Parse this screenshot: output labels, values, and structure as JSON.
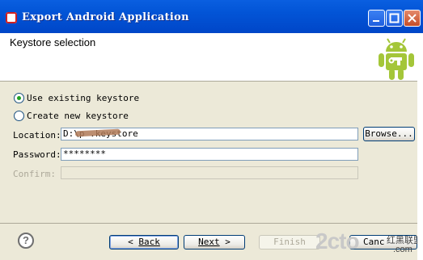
{
  "window": {
    "title": "Export Android Application"
  },
  "header": {
    "title": "Keystore selection"
  },
  "options": {
    "use_existing": "Use existing keystore",
    "create_new": "Create new keystore",
    "selected": "use_existing"
  },
  "fields": {
    "location_label": "Location:",
    "location_value": "D:\\p    .keystore",
    "browse_label": "Browse...",
    "password_label": "Password:",
    "password_value": "********",
    "confirm_label": "Confirm:",
    "confirm_value": ""
  },
  "buttons": {
    "back_prefix": "< ",
    "back_label": "Back",
    "next_label": "Next",
    "next_suffix": " >",
    "finish_label": "Finish",
    "cancel_label": "Canc"
  },
  "watermark": {
    "brand": "2cto",
    "sub": "红黑联盟",
    "com": ".com"
  },
  "colors": {
    "title_bar": "#0254d6",
    "radio_selected": "#21a121",
    "android_green": "#a4c639"
  }
}
